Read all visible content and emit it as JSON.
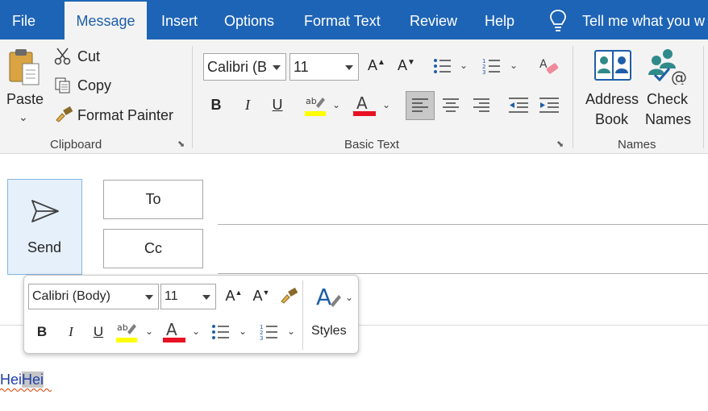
{
  "menu": {
    "tabs": [
      "File",
      "Message",
      "Insert",
      "Options",
      "Format Text",
      "Review",
      "Help"
    ],
    "active": "Message",
    "tell_me": "Tell me what you w"
  },
  "clipboard": {
    "paste": "Paste",
    "cut": "Cut",
    "copy": "Copy",
    "format_painter": "Format Painter",
    "label": "Clipboard"
  },
  "basic_text": {
    "font_name": "Calibri (B",
    "font_size": "11",
    "bold": "B",
    "italic": "I",
    "underline": "U",
    "label": "Basic Text"
  },
  "names": {
    "address_book_l1": "Address",
    "address_book_l2": "Book",
    "check_names_l1": "Check",
    "check_names_l2": "Names",
    "label": "Names"
  },
  "compose": {
    "send": "Send",
    "to": "To",
    "cc": "Cc"
  },
  "mini_toolbar": {
    "font_name": "Calibri (Body)",
    "font_size": "11",
    "bold": "B",
    "italic": "I",
    "underline": "U",
    "styles": "Styles"
  },
  "body": {
    "text_plain": "Hei",
    "text_selected": "Hei"
  },
  "colors": {
    "accent": "#1e64b6",
    "highlight": "#ffff00",
    "font_color": "#e81123"
  }
}
